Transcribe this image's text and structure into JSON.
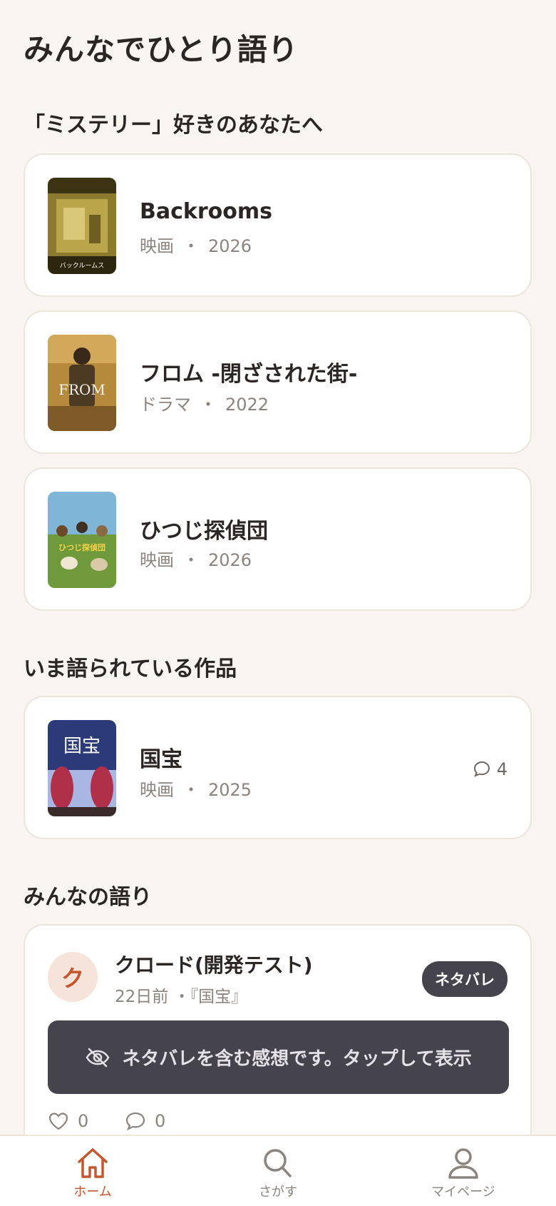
{
  "app": {
    "title": "みんなでひとり語り"
  },
  "recommend": {
    "heading": "「ミステリー」好きのあなたへ",
    "items": [
      {
        "title": "Backrooms",
        "type": "映画",
        "sep": "・",
        "year": "2026",
        "poster_text": "バックルームス"
      },
      {
        "title": "フロム -閉ざされた街-",
        "type": "ドラマ",
        "sep": "・",
        "year": "2022",
        "poster_text": "FROM"
      },
      {
        "title": "ひつじ探偵団",
        "type": "映画",
        "sep": "・",
        "year": "2026",
        "poster_text": "ひつじ探偵団"
      }
    ]
  },
  "trending": {
    "heading": "いま語られている作品",
    "items": [
      {
        "title": "国宝",
        "type": "映画",
        "sep": "・",
        "year": "2025",
        "comments": "4",
        "poster_text": "国宝"
      }
    ]
  },
  "posts": {
    "heading": "みんなの語り",
    "items": [
      {
        "avatar_initial": "ク",
        "user": "クロード(開発テスト)",
        "time": "22日前",
        "work": "・『国宝』",
        "badge": "ネタバレ",
        "spoiler_text": "ネタバレを含む感想です。タップして表示",
        "likes": "0",
        "replies": "0"
      }
    ]
  },
  "nav": {
    "items": [
      {
        "label": "ホーム",
        "icon": "home-icon",
        "active": true
      },
      {
        "label": "さがす",
        "icon": "search-icon",
        "active": false
      },
      {
        "label": "マイページ",
        "icon": "user-icon",
        "active": false
      }
    ]
  },
  "colors": {
    "accent": "#c4562e",
    "background": "#f8f5f1",
    "dark": "#45434b"
  }
}
